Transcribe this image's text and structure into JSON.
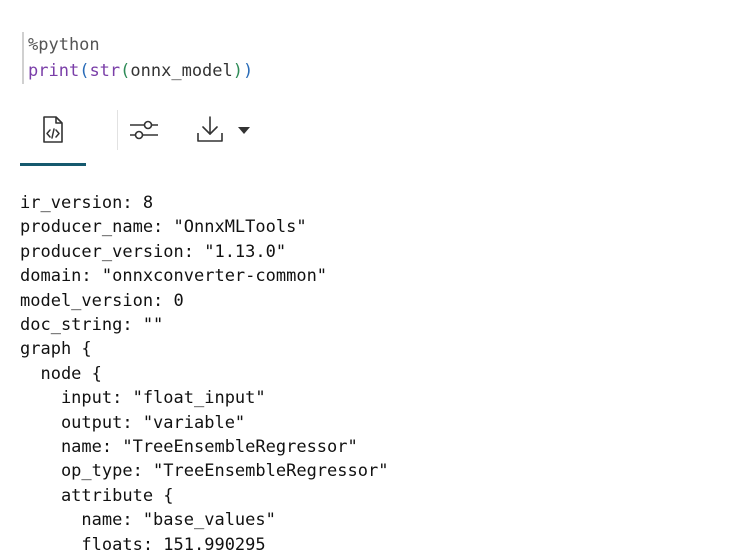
{
  "cell": {
    "magic": "%python",
    "code": {
      "func1": "print",
      "func2": "str",
      "arg": "onnx_model"
    }
  },
  "toolbar": {
    "tabs": [
      {
        "icon": "code-file-icon",
        "active": true
      },
      {
        "icon": "settings-sliders-icon",
        "active": false
      },
      {
        "icon": "download-icon",
        "active": false
      }
    ],
    "accent_color": "#15596e"
  },
  "output": {
    "lines": [
      "ir_version: 8",
      "producer_name: \"OnnxMLTools\"",
      "producer_version: \"1.13.0\"",
      "domain: \"onnxconverter-common\"",
      "model_version: 0",
      "doc_string: \"\"",
      "graph {",
      "  node {",
      "    input: \"float_input\"",
      "    output: \"variable\"",
      "    name: \"TreeEnsembleRegressor\"",
      "    op_type: \"TreeEnsembleRegressor\"",
      "    attribute {",
      "      name: \"base_values\"",
      "      floats: 151.990295"
    ]
  }
}
